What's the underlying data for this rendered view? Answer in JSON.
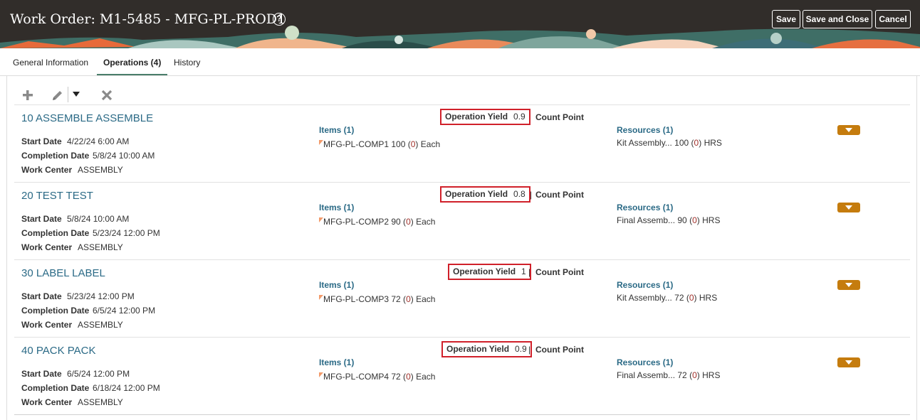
{
  "header": {
    "title": "Work Order: M1-5485 - MFG-PL-PROD1",
    "help_icon": "question-circle-icon",
    "buttons": {
      "save": "Save",
      "save_and_close": "Save and Close",
      "cancel": "Cancel"
    }
  },
  "tabs": [
    {
      "label": "General Information",
      "active": false
    },
    {
      "label": "Operations (4)",
      "active": true
    },
    {
      "label": "History",
      "active": false
    }
  ],
  "toolbar": {
    "icons": [
      "plus-icon",
      "pencil-icon",
      "dropdown-arrow-icon",
      "close-x-icon"
    ]
  },
  "labels": {
    "start_date": "Start Date",
    "completion_date": "Completion Date",
    "work_center": "Work Center",
    "operation_yield": "Operation Yield",
    "count_point": "Count Point"
  },
  "operations": [
    {
      "title": "10 ASSEMBLE ASSEMBLE",
      "start_date": "4/22/24 6:00 AM",
      "completion_date": "5/8/24 10:00 AM",
      "work_center": "ASSEMBLY",
      "yield": "0.9",
      "items_link": "Items (1)",
      "item_name": "MFG-PL-COMP1",
      "item_qty": "100",
      "item_zero": "0",
      "item_uom": "Each",
      "resources_link": "Resources (1)",
      "resource_name": "Kit Assembly...",
      "resource_qty": "100",
      "resource_zero": "0",
      "resource_uom": "HRS"
    },
    {
      "title": "20 TEST TEST",
      "start_date": "5/8/24 10:00 AM",
      "completion_date": "5/23/24 12:00 PM",
      "work_center": "ASSEMBLY",
      "yield": "0.8",
      "items_link": "Items (1)",
      "item_name": "MFG-PL-COMP2",
      "item_qty": "90",
      "item_zero": "0",
      "item_uom": "Each",
      "resources_link": "Resources (1)",
      "resource_name": "Final Assemb...",
      "resource_qty": "90",
      "resource_zero": "0",
      "resource_uom": "HRS"
    },
    {
      "title": "30 LABEL LABEL",
      "start_date": "5/23/24 12:00 PM",
      "completion_date": "6/5/24 12:00 PM",
      "work_center": "ASSEMBLY",
      "yield": "1",
      "items_link": "Items (1)",
      "item_name": "MFG-PL-COMP3",
      "item_qty": "72",
      "item_zero": "0",
      "item_uom": "Each",
      "resources_link": "Resources (1)",
      "resource_name": "Kit Assembly...",
      "resource_qty": "72",
      "resource_zero": "0",
      "resource_uom": "HRS"
    },
    {
      "title": "40 PACK PACK",
      "start_date": "6/5/24 12:00 PM",
      "completion_date": "6/18/24 12:00 PM",
      "work_center": "ASSEMBLY",
      "yield": "0.9",
      "items_link": "Items (1)",
      "item_name": "MFG-PL-COMP4",
      "item_qty": "72",
      "item_zero": "0",
      "item_uom": "Each",
      "resources_link": "Resources (1)",
      "resource_name": "Final Assemb...",
      "resource_qty": "72",
      "resource_zero": "0",
      "resource_uom": "HRS"
    }
  ],
  "colors": {
    "header_bg": "#312d2a",
    "link": "#2b6a86",
    "highlight": "#d0202a",
    "action": "#c57c0e"
  }
}
